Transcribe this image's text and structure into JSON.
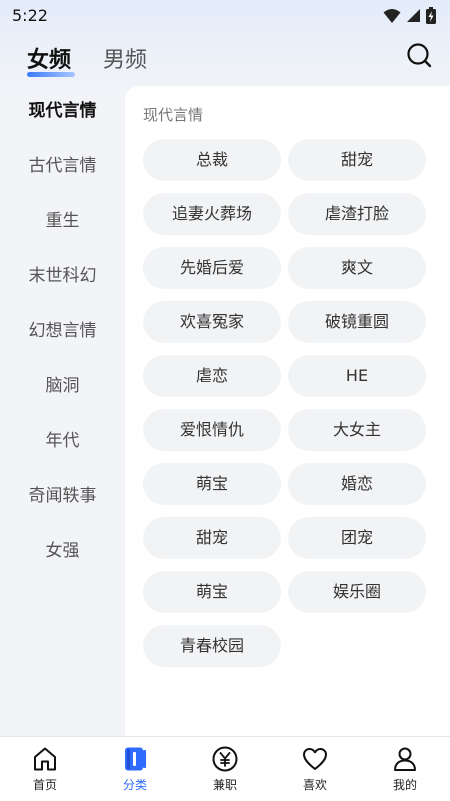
{
  "status": {
    "time": "5:22"
  },
  "header": {
    "tab_female": "女频",
    "tab_male": "男频"
  },
  "sidebar": {
    "items": [
      {
        "label": "现代言情"
      },
      {
        "label": "古代言情"
      },
      {
        "label": "重生"
      },
      {
        "label": "末世科幻"
      },
      {
        "label": "幻想言情"
      },
      {
        "label": "脑洞"
      },
      {
        "label": "年代"
      },
      {
        "label": "奇闻轶事"
      },
      {
        "label": "女强"
      }
    ]
  },
  "content": {
    "title": "现代言情",
    "tags": [
      "总裁",
      "甜宠",
      "追妻火葬场",
      "虐渣打脸",
      "先婚后爱",
      "爽文",
      "欢喜冤家",
      "破镜重圆",
      "虐恋",
      "HE",
      "爱恨情仇",
      "大女主",
      "萌宝",
      "婚恋",
      "甜宠",
      "团宠",
      "萌宝",
      "娱乐圈",
      "青春校园"
    ]
  },
  "nav": {
    "home": "首页",
    "category": "分类",
    "parttime": "兼职",
    "like": "喜欢",
    "mine": "我的"
  },
  "colors": {
    "accent": "#2f6bff",
    "tag_bg": "#f2f3f5"
  }
}
